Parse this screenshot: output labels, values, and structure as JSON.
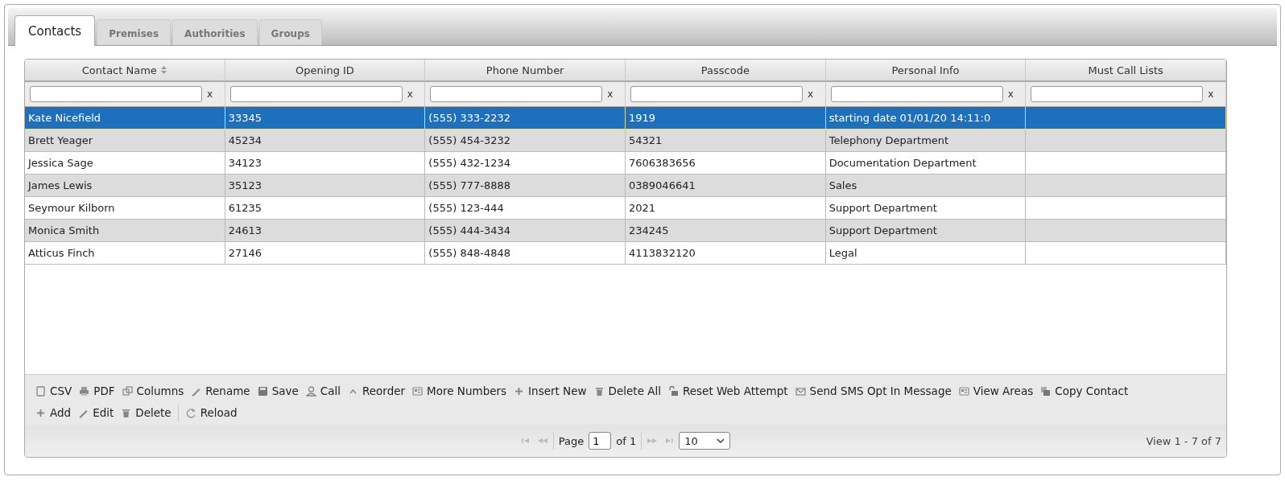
{
  "tabs": [
    {
      "label": "Contacts",
      "selected": true
    },
    {
      "label": "Premises",
      "selected": false
    },
    {
      "label": "Authorities",
      "selected": false
    },
    {
      "label": "Groups",
      "selected": false
    }
  ],
  "table": {
    "columns": [
      {
        "label": "Contact Name",
        "sortable": true
      },
      {
        "label": "Opening ID",
        "sortable": false
      },
      {
        "label": "Phone Number",
        "sortable": false
      },
      {
        "label": "Passcode",
        "sortable": false
      },
      {
        "label": "Personal Info",
        "sortable": false
      },
      {
        "label": "Must Call Lists",
        "sortable": false
      }
    ],
    "filter_clear": [
      "x",
      "x",
      "x",
      "x",
      "x",
      "x"
    ],
    "rows": [
      {
        "selected": true,
        "cells": [
          "Kate Nicefield",
          "33345",
          "(555) 333-2232",
          "1919",
          "starting date 01/01/20 14:11:0",
          ""
        ]
      },
      {
        "selected": false,
        "cells": [
          "Brett Yeager",
          "45234",
          "(555) 454-3232",
          "54321",
          "Telephony Department",
          ""
        ]
      },
      {
        "selected": false,
        "cells": [
          "Jessica Sage",
          "34123",
          "(555) 432-1234",
          "7606383656",
          "Documentation Department",
          ""
        ]
      },
      {
        "selected": false,
        "cells": [
          "James Lewis",
          "35123",
          "(555) 777-8888",
          "0389046641",
          "Sales",
          ""
        ]
      },
      {
        "selected": false,
        "cells": [
          "Seymour Kilborn",
          "61235",
          "(555) 123-444",
          "2021",
          "Support Department",
          ""
        ]
      },
      {
        "selected": false,
        "cells": [
          "Monica Smith",
          "24613",
          "(555) 444-3434",
          "234245",
          "Support Department",
          ""
        ]
      },
      {
        "selected": false,
        "cells": [
          "Atticus Finch",
          "27146",
          "(555) 848-4848",
          "4113832120",
          "Legal",
          ""
        ]
      }
    ]
  },
  "toolbar": {
    "rows": [
      [
        "CSV",
        "PDF",
        "Columns",
        "Rename",
        "Save",
        "Call",
        "Reorder",
        "More Numbers",
        "Insert New",
        "Delete All",
        "Reset Web Attempt",
        "Send SMS Opt In Message",
        "View Areas",
        "Copy Contact"
      ],
      [
        "Add",
        "Edit",
        "Delete",
        "Reload"
      ]
    ]
  },
  "pager": {
    "page_label": "Page",
    "page": "1",
    "of_label": "of 1",
    "page_size": "10",
    "summary": "View 1 - 7 of 7"
  }
}
